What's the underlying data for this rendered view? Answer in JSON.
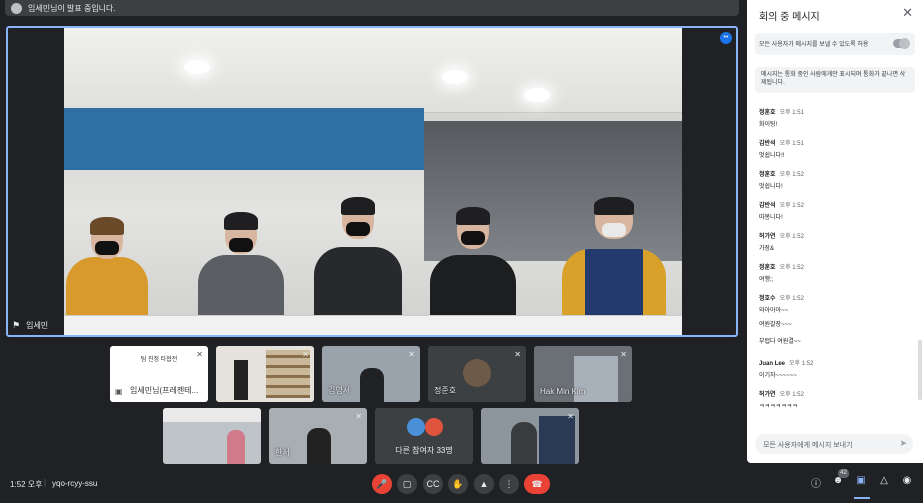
{
  "topbar": {
    "presenting_text": "임세민님이 발표 중입니다."
  },
  "main": {
    "speaker_name": "임세민"
  },
  "tiles": [
    {
      "label": "임세민님(프레젠테..."
    },
    {
      "label": ""
    },
    {
      "label": "김영서"
    },
    {
      "label": "정준호"
    },
    {
      "label": "Hak Min Kim"
    },
    {
      "label": ""
    },
    {
      "label": "한서"
    },
    {
      "label": "다른 참여자 33명"
    },
    {
      "label": ""
    }
  ],
  "slide": {
    "text": "팀 진정 타협전"
  },
  "panel": {
    "title": "회의 중 메시지",
    "allow_text": "모든 사용자가 메시지를 보낼 수 있도록 허용",
    "info_text": "메시지는 통화 중인 사람에게만 표시되며 통화가 끝나면 삭제됩니다.",
    "messages": [
      {
        "who": "정훈호",
        "time": "오후 1:51",
        "text": "화이팅!"
      },
      {
        "who": "김반석",
        "time": "오후 1:51",
        "text": "멋쉽니다!!"
      },
      {
        "who": "정훈호",
        "time": "오후 1:52",
        "text": "멋쉽니다!"
      },
      {
        "who": "김반석",
        "time": "오후 1:52",
        "text": "따봉니다!"
      },
      {
        "who": "허가연",
        "time": "오후 1:52",
        "text": "가장&"
      },
      {
        "who": "정훈호",
        "time": "오후 1:52",
        "text": "여행;;"
      },
      {
        "who": "정호수",
        "time": "오후 1:52",
        "text": "와아아아~~"
      },
      {
        "who": "",
        "time": "",
        "text": "여원갈장~~~"
      },
      {
        "who": "",
        "time": "",
        "text": "부럽다 여원결~~"
      },
      {
        "who": "Juan Lee",
        "time": "오후 1:52",
        "text": "이기자~~~~~~"
      },
      {
        "who": "허가연",
        "time": "오후 1:52",
        "text": "ㅋㅋㅋㅋㅋㅋㅋ"
      }
    ],
    "input_placeholder": "모든 사용자에게 메시지 보내기"
  },
  "bottom": {
    "time": "1:52 오후",
    "separator": "|",
    "meeting_code": "yqo-rcyy-ssu",
    "participants_count": "42"
  },
  "colors": {
    "accent": "#8ab4f8",
    "end_call": "#ea4335",
    "bg": "#202124"
  }
}
